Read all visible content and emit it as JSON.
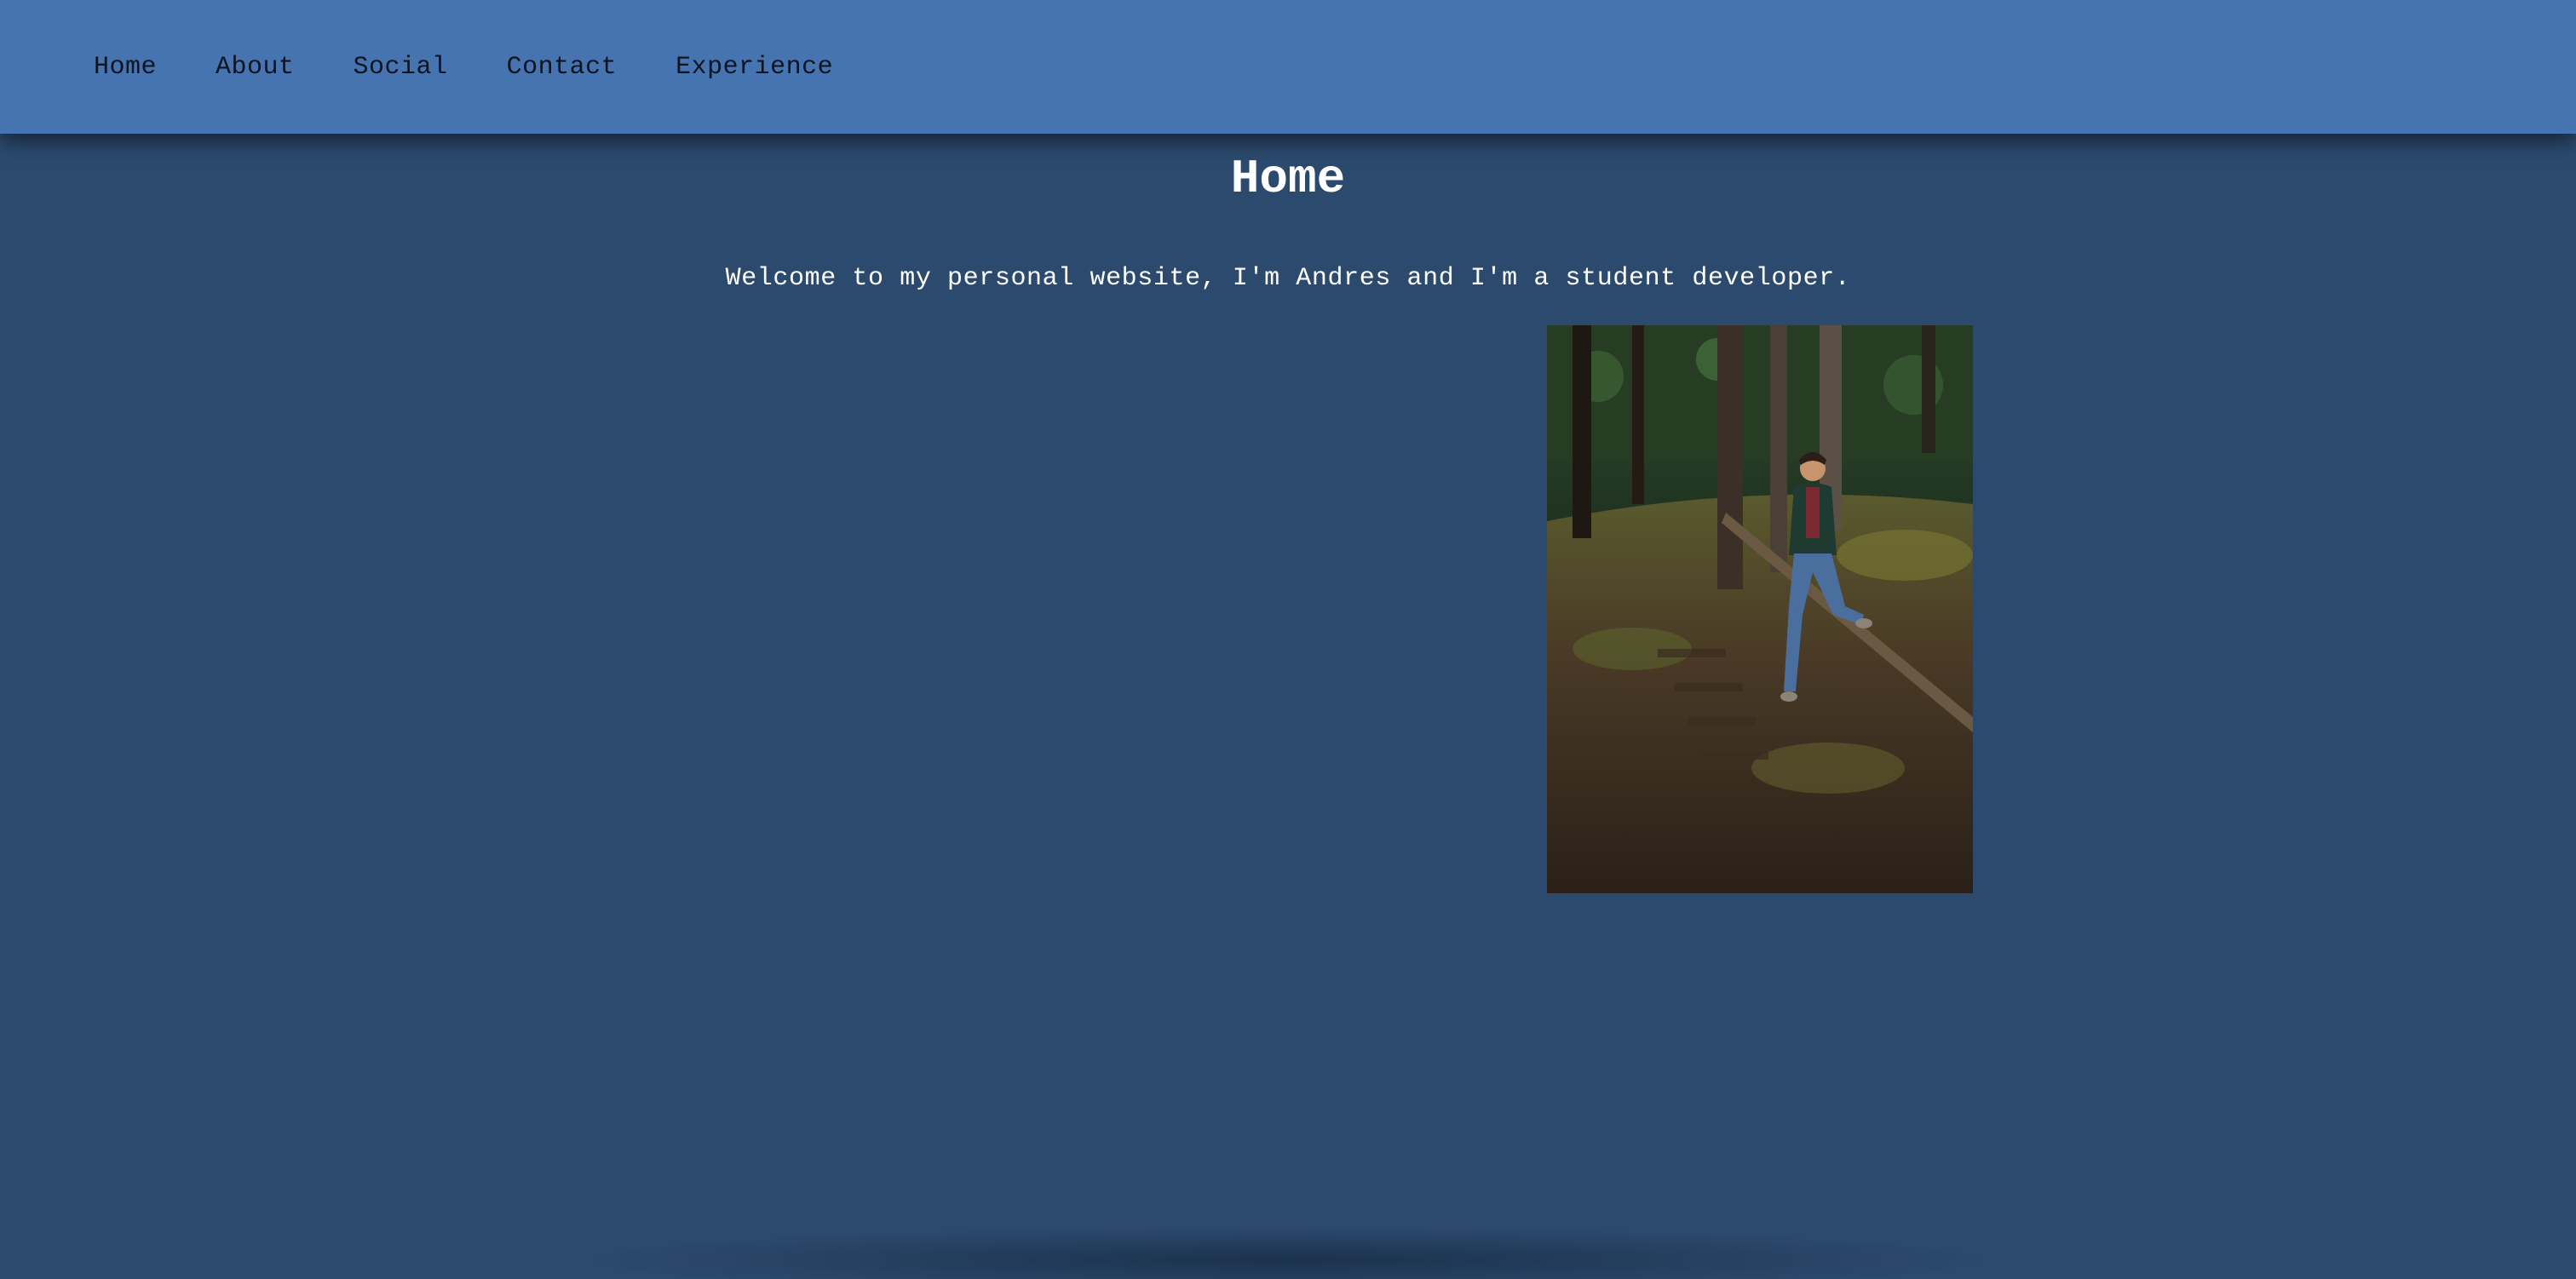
{
  "nav": {
    "items": [
      {
        "label": "Home"
      },
      {
        "label": "About"
      },
      {
        "label": "Social"
      },
      {
        "label": "Contact"
      },
      {
        "label": "Experience"
      }
    ]
  },
  "main": {
    "title": "Home",
    "welcome_text": "Welcome to my personal website, I'm Andres and I'm a student developer."
  },
  "colors": {
    "navbar": "#4574b0",
    "background": "#2c4a6e",
    "text": "#ffffff",
    "nav_text": "#0d1420"
  }
}
